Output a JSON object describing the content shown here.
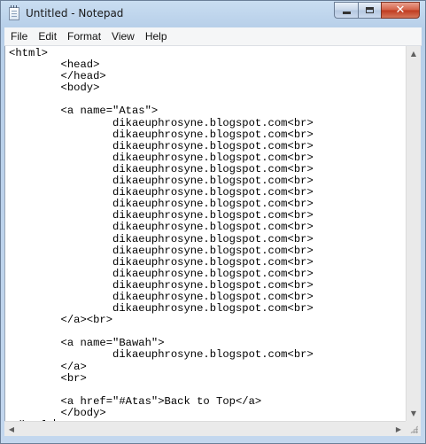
{
  "window": {
    "title": "Untitled - Notepad",
    "icon": "notepad-icon",
    "controls": {
      "minimize_icon": "minimize-icon",
      "maximize_icon": "maximize-icon",
      "close_glyph": "✕"
    }
  },
  "menu": {
    "items": [
      {
        "label": "File"
      },
      {
        "label": "Edit"
      },
      {
        "label": "Format"
      },
      {
        "label": "View"
      },
      {
        "label": "Help"
      }
    ]
  },
  "editor": {
    "content": "<html>\n\t<head>\n\t</head>\n\t<body>\n\n\t<a name=\"Atas\">\n\t\tdikaeuphrosyne.blogspot.com<br>\n\t\tdikaeuphrosyne.blogspot.com<br>\n\t\tdikaeuphrosyne.blogspot.com<br>\n\t\tdikaeuphrosyne.blogspot.com<br>\n\t\tdikaeuphrosyne.blogspot.com<br>\n\t\tdikaeuphrosyne.blogspot.com<br>\n\t\tdikaeuphrosyne.blogspot.com<br>\n\t\tdikaeuphrosyne.blogspot.com<br>\n\t\tdikaeuphrosyne.blogspot.com<br>\n\t\tdikaeuphrosyne.blogspot.com<br>\n\t\tdikaeuphrosyne.blogspot.com<br>\n\t\tdikaeuphrosyne.blogspot.com<br>\n\t\tdikaeuphrosyne.blogspot.com<br>\n\t\tdikaeuphrosyne.blogspot.com<br>\n\t\tdikaeuphrosyne.blogspot.com<br>\n\t\tdikaeuphrosyne.blogspot.com<br>\n\t\tdikaeuphrosyne.blogspot.com<br>\n\t</a><br>\n\n\t<a name=\"Bawah\">\n\t\tdikaeuphrosyne.blogspot.com<br>\n\t</a>\n\t<br>\n\n\t<a href=\"#Atas\">Back to Top</a>\n\t</body>\n</html>"
  },
  "colors": {
    "frame": "#c3d7ee",
    "close_button": "#c0391e",
    "menubar_bg": "#f5f6f7",
    "editor_bg": "#ffffff",
    "text": "#000000"
  }
}
